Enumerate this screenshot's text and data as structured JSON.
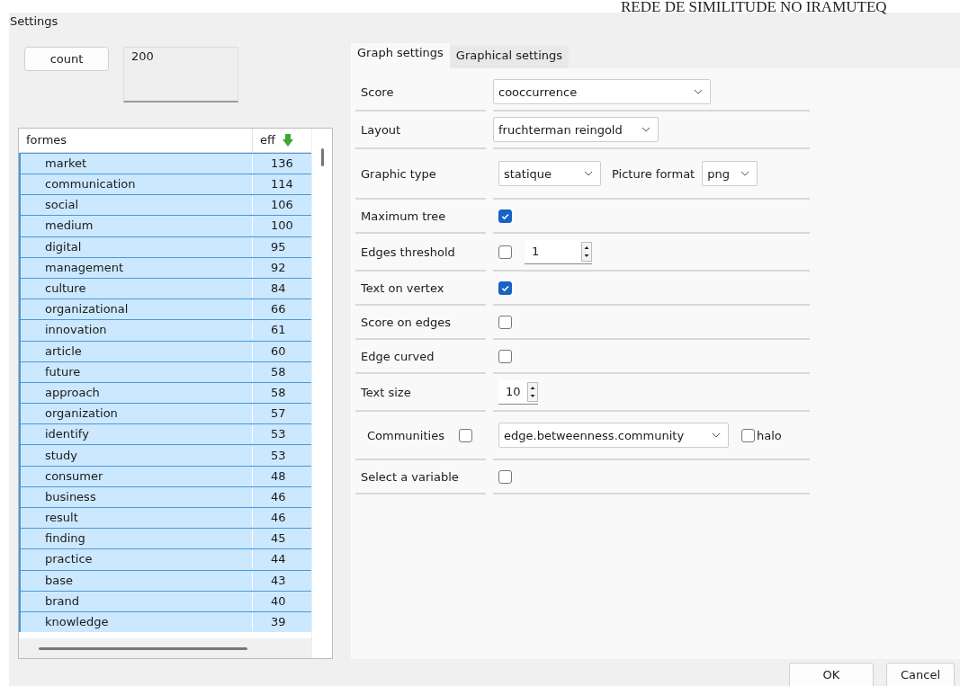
{
  "caption": "REDE DE SIMILITUDE NO IRAMUTEQ",
  "window": {
    "title": "Settings"
  },
  "count_button": "count",
  "count_value": "200",
  "table": {
    "columns": [
      {
        "label": "formes"
      },
      {
        "label": "eff",
        "sorted": true
      }
    ],
    "rows": [
      {
        "cells": [
          "market",
          "136"
        ],
        "selected": true
      },
      {
        "cells": [
          "communication",
          "114"
        ],
        "selected": true
      },
      {
        "cells": [
          "social",
          "106"
        ],
        "selected": true
      },
      {
        "cells": [
          "medium",
          "100"
        ],
        "selected": true
      },
      {
        "cells": [
          "digital",
          "95"
        ],
        "selected": true
      },
      {
        "cells": [
          "management",
          "92"
        ],
        "selected": true
      },
      {
        "cells": [
          "culture",
          "84"
        ],
        "selected": true
      },
      {
        "cells": [
          "organizational",
          "66"
        ],
        "selected": true
      },
      {
        "cells": [
          "innovation",
          "61"
        ],
        "selected": true
      },
      {
        "cells": [
          "article",
          "60"
        ],
        "selected": true
      },
      {
        "cells": [
          "future",
          "58"
        ],
        "selected": true
      },
      {
        "cells": [
          "approach",
          "58"
        ],
        "selected": true
      },
      {
        "cells": [
          "organization",
          "57"
        ],
        "selected": true
      },
      {
        "cells": [
          "identify",
          "53"
        ],
        "selected": true
      },
      {
        "cells": [
          "study",
          "53"
        ],
        "selected": true
      },
      {
        "cells": [
          "consumer",
          "48"
        ],
        "selected": true
      },
      {
        "cells": [
          "business",
          "46"
        ],
        "selected": true
      },
      {
        "cells": [
          "result",
          "46"
        ],
        "selected": true
      },
      {
        "cells": [
          "finding",
          "45"
        ],
        "selected": true
      },
      {
        "cells": [
          "practice",
          "44"
        ],
        "selected": true
      },
      {
        "cells": [
          "base",
          "43"
        ],
        "selected": true
      },
      {
        "cells": [
          "brand",
          "40"
        ],
        "selected": true
      },
      {
        "cells": [
          "knowledge",
          "39"
        ],
        "selected": true
      }
    ]
  },
  "tabs": [
    {
      "label": "Graph settings",
      "selected": true
    },
    {
      "label": "Graphical settings",
      "selected": false
    }
  ],
  "settings": [
    {
      "kind": "select",
      "label": "Score",
      "value": "cooccurrence"
    },
    {
      "kind": "select",
      "label": "Layout",
      "value": "fruchterman reingold"
    },
    {
      "kind": "select_pair",
      "label": "Graphic type",
      "value": "statique",
      "label_2": "Picture format",
      "value_2": "png"
    },
    {
      "kind": "checkbox",
      "label": "Maximum tree",
      "checked": true
    },
    {
      "kind": "checkbox_spin",
      "label": "Edges threshold",
      "checked": false,
      "value": "1"
    },
    {
      "kind": "checkbox",
      "label": "Text on vertex",
      "checked": true
    },
    {
      "kind": "checkbox",
      "label": "Score on edges",
      "checked": false
    },
    {
      "kind": "checkbox",
      "label": "Edge curved",
      "checked": false
    },
    {
      "kind": "spin",
      "label": "Text size",
      "value": "10"
    },
    {
      "kind": "communities",
      "label": "Communities",
      "checked": false,
      "value": "edge.betweenness.community",
      "halo_label": "halo",
      "halo_checked": false
    },
    {
      "kind": "checkbox",
      "label": "Select a variable",
      "checked": false
    }
  ],
  "buttons": [
    "OK",
    "Cancel"
  ]
}
